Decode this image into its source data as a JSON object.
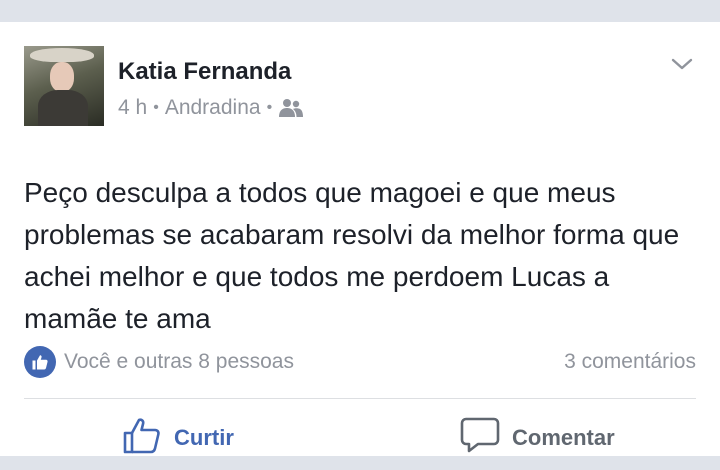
{
  "post": {
    "author": "Katia Fernanda",
    "time": "4 h",
    "location": "Andradina",
    "privacy_icon": "friends-icon",
    "text": "Peço desculpa a todos que magoei e que meus problemas se acabaram resolvi da melhor forma que achei melhor e que todos me perdoem Lucas a mamãe te ama"
  },
  "reactions": {
    "summary": "Você e outras 8 pessoas",
    "comments": "3 comentários"
  },
  "actions": {
    "like_label": "Curtir",
    "comment_label": "Comentar"
  },
  "colors": {
    "brand_blue": "#4267b2",
    "muted_text": "#90949c",
    "body_text": "#1d2129"
  }
}
